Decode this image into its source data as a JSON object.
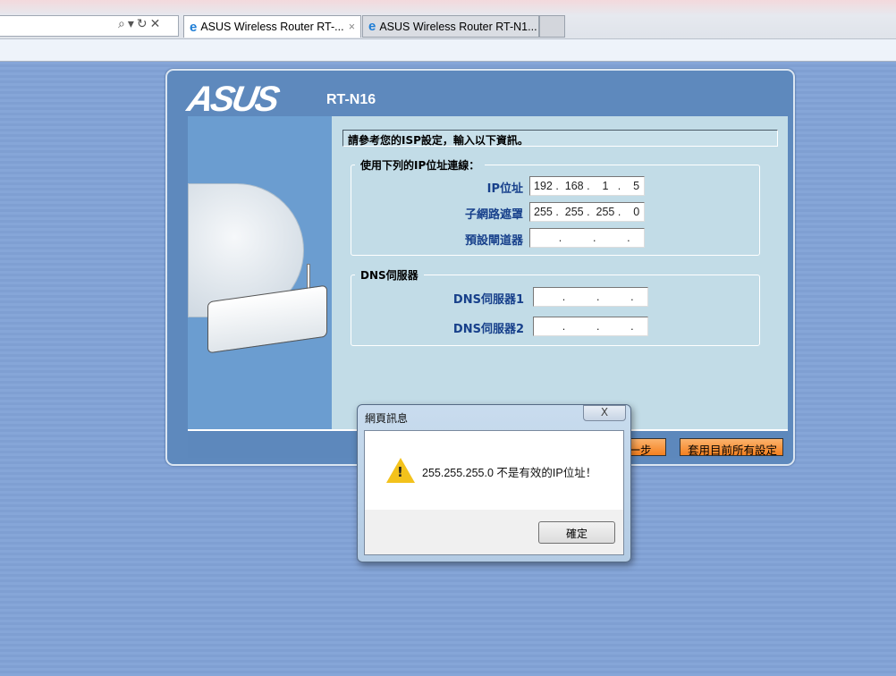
{
  "browser": {
    "tabs": [
      {
        "label": "ASUS Wireless Router RT-...",
        "active": true
      },
      {
        "label": "ASUS Wireless Router RT-N1...",
        "active": false
      }
    ],
    "address_icons": "⌕▾↻✕",
    "tab_close": "×"
  },
  "router": {
    "brand": "ASUS",
    "model": "RT-N16",
    "instruction": "請參考您的ISP設定，輸入以下資訊。",
    "ip_section": {
      "legend": "使用下列的IP位址連線：",
      "fields": [
        {
          "label": "IP位址",
          "value": "192 .  168 .    1   .    5"
        },
        {
          "label": "子網路遮罩",
          "value": "255 .  255 .  255 .    0"
        },
        {
          "label": "預設閘道器",
          "value": "        .          .          ."
        }
      ]
    },
    "dns_section": {
      "legend": "DNS伺服器",
      "fields": [
        {
          "label": "DNS伺服器1",
          "value": "        .          .          ."
        },
        {
          "label": "DNS伺服器2",
          "value": "        .          .          ."
        }
      ]
    },
    "prev_button": "上一步",
    "apply_button": "套用目前所有設定"
  },
  "dialog": {
    "title": "網頁訊息",
    "close": "X",
    "message": "255.255.255.0 不是有效的IP位址！",
    "ok": "確定",
    "icon": "warning-icon"
  }
}
